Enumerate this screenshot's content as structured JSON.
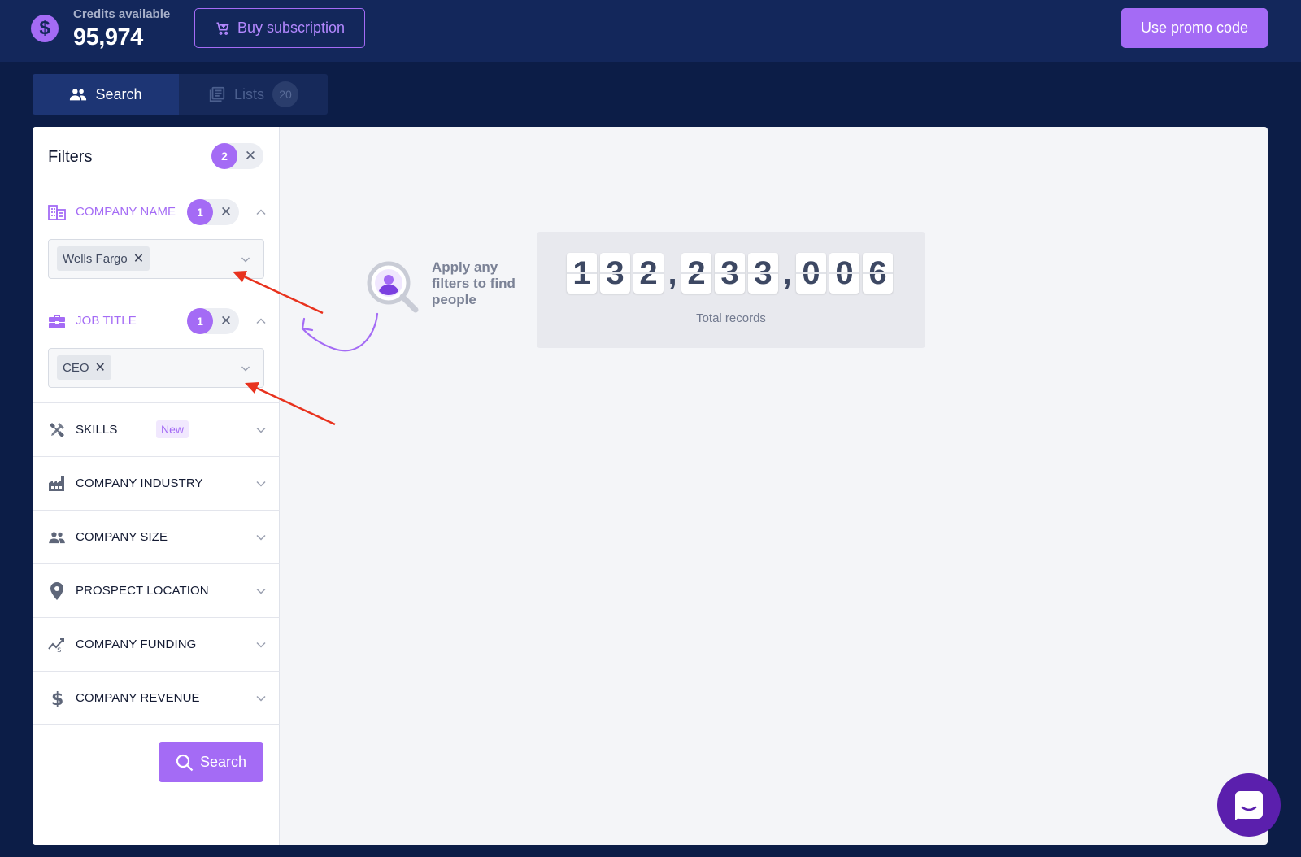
{
  "header": {
    "credits_label": "Credits available",
    "credits_value": "95,974",
    "credits_icon": "dollar-icon",
    "buy_label": "Buy subscription",
    "promo_label": "Use promo code"
  },
  "tabs": {
    "search_label": "Search",
    "lists_label": "Lists",
    "lists_count": "20"
  },
  "filters": {
    "title": "Filters",
    "active_count": "2",
    "company_name": {
      "label": "COMPANY NAME",
      "count": "1",
      "chip": "Wells Fargo"
    },
    "job_title": {
      "label": "JOB TITLE",
      "count": "1",
      "chip": "CEO"
    },
    "skills": {
      "label": "SKILLS",
      "badge": "New"
    },
    "company_industry": "COMPANY INDUSTRY",
    "company_size": "COMPANY SIZE",
    "prospect_location": "PROSPECT LOCATION",
    "company_funding": "COMPANY FUNDING",
    "company_revenue": "COMPANY REVENUE",
    "search_button": "Search"
  },
  "hint": {
    "text": "Apply any filters to find people"
  },
  "counter": {
    "digits": [
      "1",
      "3",
      "2",
      ",",
      "2",
      "3",
      "3",
      ",",
      "0",
      "0",
      "6"
    ],
    "label": "Total records"
  },
  "colors": {
    "accent": "#a46bf5",
    "header_bg": "#13275b",
    "page_bg": "#0c1d47",
    "annotation_red": "#e8321e"
  }
}
